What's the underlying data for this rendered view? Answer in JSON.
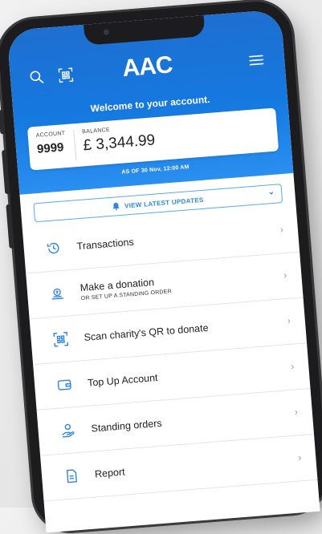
{
  "app": {
    "logo_text": "AAC",
    "welcome": "Welcome to your account.",
    "brand_color": "#1579e0"
  },
  "account": {
    "account_label": "ACCOUNT",
    "account_number": "9999",
    "balance_label": "BALANCE",
    "balance_value": "£ 3,344.99",
    "as_of": "AS OF 30 Nov, 12:00 AM"
  },
  "updates": {
    "label": "VIEW LATEST UPDATES"
  },
  "menu": [
    {
      "label": "Transactions",
      "sublabel": "",
      "icon": "history-icon"
    },
    {
      "label": "Make a donation",
      "sublabel": "OR SET UP A STANDING ORDER",
      "icon": "donation-icon"
    },
    {
      "label": "Scan charity's QR to donate",
      "sublabel": "",
      "icon": "qr-scan-icon"
    },
    {
      "label": "Top Up Account",
      "sublabel": "",
      "icon": "wallet-icon"
    },
    {
      "label": "Standing orders",
      "sublabel": "",
      "icon": "hand-coin-icon"
    },
    {
      "label": "Report",
      "sublabel": "",
      "icon": "report-icon"
    }
  ]
}
